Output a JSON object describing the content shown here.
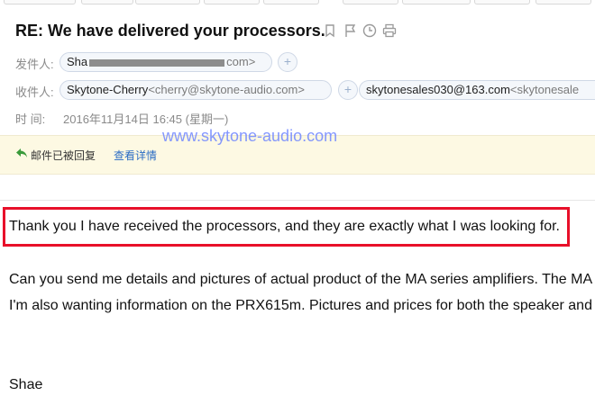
{
  "subject": "RE: We have delivered your processors.",
  "header_icons": [
    "bookmark-icon",
    "flag-icon",
    "clock-icon",
    "print-icon"
  ],
  "sender": {
    "label": "发件人:",
    "name_visible_start": "Sha",
    "name_visible_end": "com>"
  },
  "recipients": {
    "label": "收件人:",
    "items": [
      {
        "name": "Skytone-Cherry",
        "address": "<cherry@skytone-audio.com>"
      },
      {
        "name": "skytonesales030@163.com",
        "address": "<skytonesale"
      }
    ]
  },
  "time": {
    "label": "时    间:",
    "value": "2016年11月14日 16:45 (星期一)"
  },
  "notice": {
    "text": "邮件已被回复",
    "link": "查看详情"
  },
  "watermark": "www.skytone-audio.com",
  "body": {
    "line1": "Thank you I have received the processors, and they are exactly what I was looking for.",
    "line2": "Can you send me details and pictures of actual product of the MA series amplifiers. The MA",
    "line3": "I'm also wanting information on the PRX615m. Pictures and prices for both the speaker and",
    "signature": "Shae"
  },
  "colors": {
    "highlight_border": "#e8102a",
    "link": "#2a6cc4",
    "notice_bg": "#fdf9e3",
    "chip_bg": "#f4f7fb"
  }
}
